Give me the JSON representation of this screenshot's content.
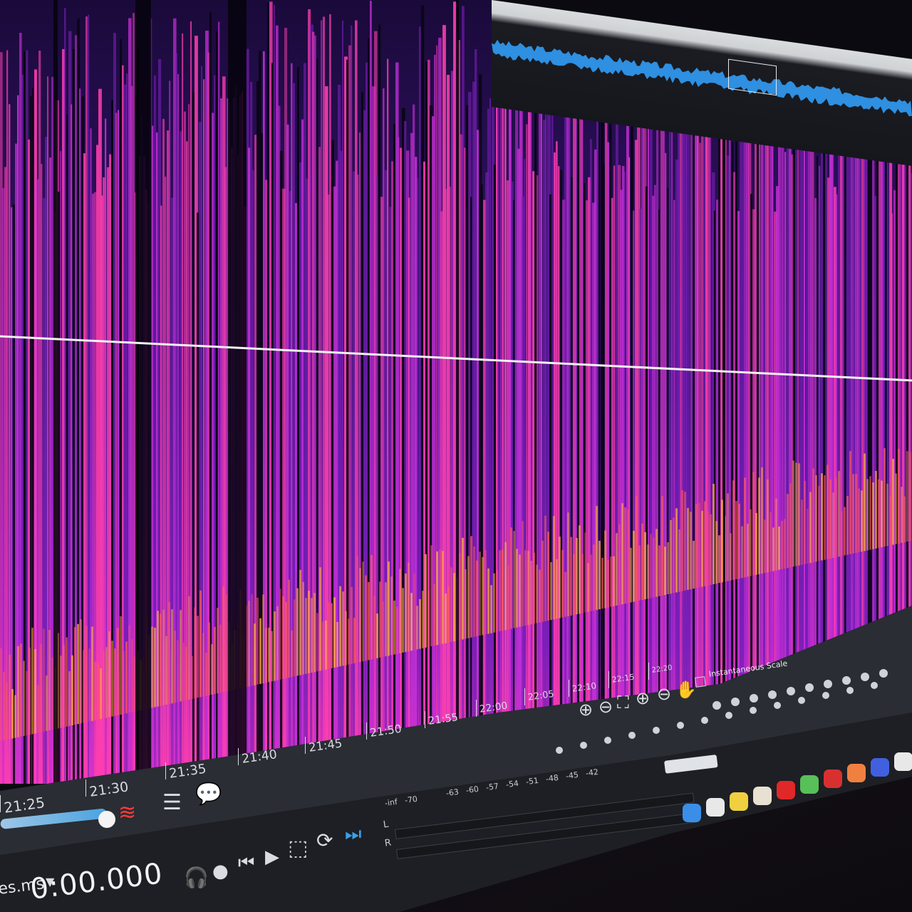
{
  "window": {
    "app": "audio-editor",
    "view": "spectral-frequency-display"
  },
  "timeline": {
    "ticks": [
      "21:25",
      "21:30",
      "21:35",
      "21:40",
      "21:45",
      "21:50",
      "21:55",
      "22:00",
      "22:05",
      "22:10",
      "22:15",
      "22:20"
    ]
  },
  "spectrogram": {
    "colormap": [
      "#120a2a",
      "#3a1478",
      "#7a1fb8",
      "#c52fd8",
      "#ff3fb0",
      "#ff5a5a",
      "#ffb03a"
    ],
    "playhead_color": "#f2f2f2"
  },
  "transport": {
    "timecode": "0:00.000",
    "file_label": "es.ms"
  },
  "meter": {
    "labels": [
      "-inf",
      "-70",
      "-63",
      "-60",
      "-57",
      "-54",
      "-51",
      "-48",
      "-45",
      "-42"
    ],
    "channel_top": "L",
    "channel_bottom": "R"
  },
  "checkbox_label": "Instantaneous Scale",
  "overview": {
    "wave_color": "#2f8fe0"
  },
  "icons": {
    "zoom_in": "zoom-in-icon",
    "zoom_out": "zoom-out-icon",
    "zoom_fit": "zoom-fit-icon",
    "zoom_selection": "zoom-selection-icon",
    "zoom_reset": "zoom-reset-icon",
    "hand": "hand-icon",
    "spectral": "spectral-wave-icon",
    "notes": "notes-icon",
    "comment": "comment-icon",
    "headphones": "headphones-icon",
    "record": "record-icon",
    "skip_back": "skip-back-icon",
    "play": "play-icon",
    "play_selection": "play-selection-icon",
    "loop": "loop-icon",
    "skip_forward": "skip-forward-icon"
  }
}
